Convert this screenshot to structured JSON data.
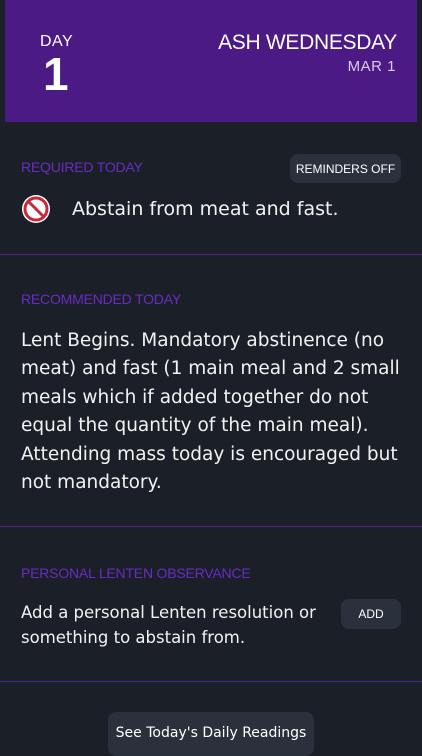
{
  "header": {
    "day_label": "DAY",
    "day_number": "1",
    "title": "ASH WEDNESDAY",
    "date": "MAR 1"
  },
  "required": {
    "label": "REQUIRED TODAY",
    "reminders_button": "REMINDERS OFF",
    "icon": "prohibited-icon",
    "text": "Abstain from meat and fast."
  },
  "recommended": {
    "label": "RECOMMENDED TODAY",
    "text": "Lent Begins. Mandatory abstinence (no meat) and fast (1 main meal and 2 small meals which if added together do not equal the quantity of the main meal). Attending mass today is encouraged but not mandatory."
  },
  "personal": {
    "label": "PERSONAL LENTEN OBSERVANCE",
    "text": "Add a personal Lenten resolution or something to abstain from.",
    "add_button": "ADD"
  },
  "readings_button": "See Today's Daily Readings",
  "colors": {
    "background": "#1b2028",
    "header": "#4b1a85",
    "accent_label": "#6a2bc4",
    "divider": "#4d248a",
    "button": "#2a313c",
    "icon_red": "#c8283a"
  }
}
